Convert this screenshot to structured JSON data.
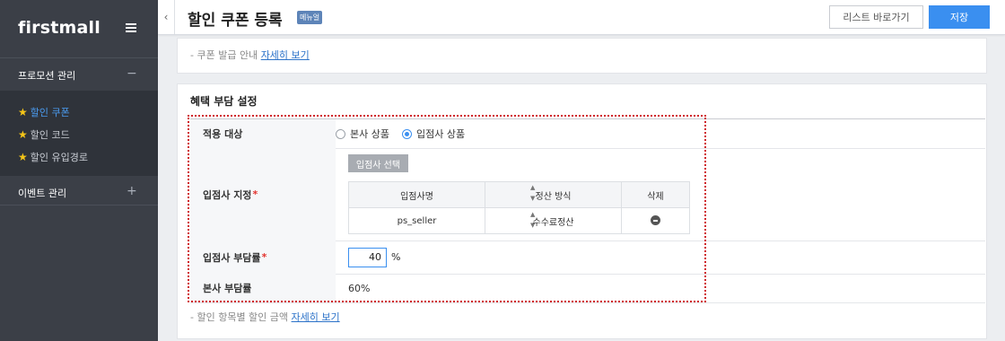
{
  "sidebar": {
    "logo": "firstmall",
    "groups": [
      {
        "label": "프로모션 관리",
        "toggle": "−"
      },
      {
        "label": "이벤트 관리",
        "toggle": "+"
      }
    ],
    "sub_items": [
      {
        "label": "할인 쿠폰",
        "active": true
      },
      {
        "label": "할인 코드",
        "active": false
      },
      {
        "label": "할인 유입경로",
        "active": false
      }
    ]
  },
  "header": {
    "back": "‹",
    "title": "할인 쿠폰 등록",
    "badge": "메뉴얼",
    "list_button": "리스트 바로가기",
    "save_button": "저장"
  },
  "top_note": {
    "text": "- 쿠폰 발급 안내",
    "link": "자세히 보기"
  },
  "benefit": {
    "title": "혜택 부담 설정",
    "target": {
      "label": "적용 대상",
      "options": [
        "본사 상품",
        "입점사 상품"
      ],
      "selected": "입점사 상품"
    },
    "seller_assign": {
      "label": "입점사 지정",
      "select_button": "입점사 선택",
      "columns": [
        "입점사명",
        "정산 방식",
        "삭제"
      ],
      "rows": [
        [
          "ps_seller",
          "수수료정산"
        ]
      ]
    },
    "seller_rate": {
      "label": "입점사 부담률",
      "value": "40",
      "unit": "%"
    },
    "hq_rate": {
      "label": "본사 부담률",
      "value": "60%"
    },
    "bottom_note": {
      "text": "- 할인 항목별 할인 금액",
      "link": "자세히 보기"
    }
  },
  "colors": {
    "accent": "#3a8ff0",
    "sidebar_bg": "#3b3f47",
    "highlight_border": "#d0262b"
  }
}
